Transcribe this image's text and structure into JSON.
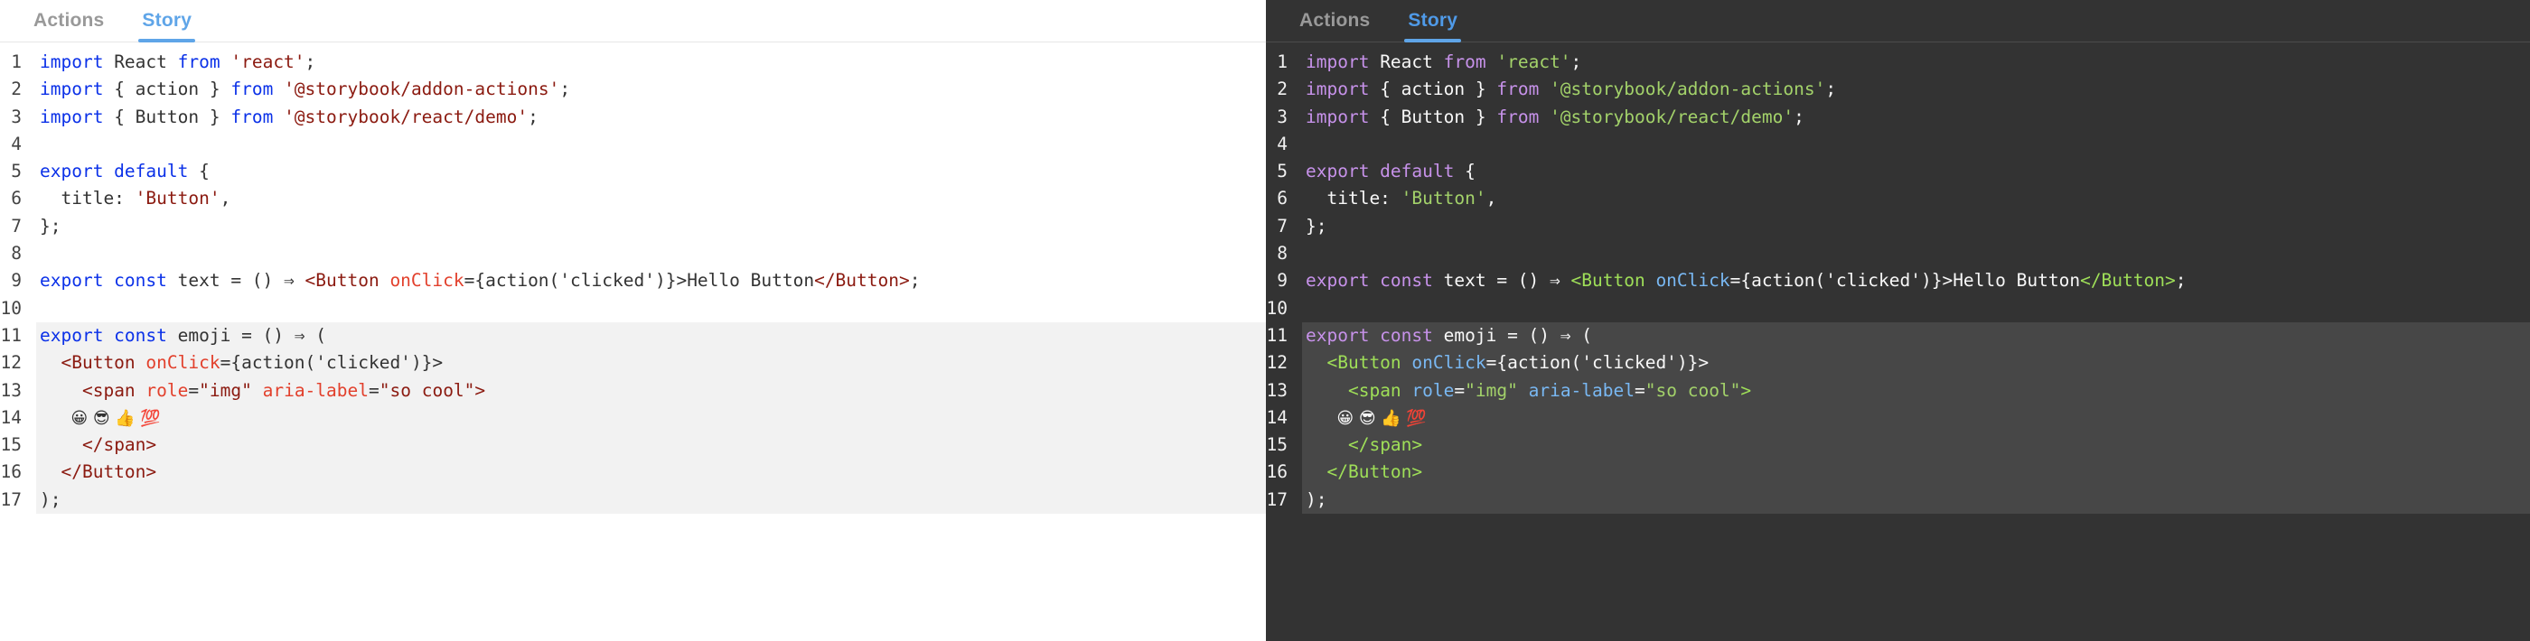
{
  "panels": [
    {
      "theme": "light",
      "tabs": [
        {
          "label": "Actions",
          "active": false
        },
        {
          "label": "Story",
          "active": true
        }
      ],
      "accent_color": "#5fa5e8",
      "background_color": "#ffffff",
      "highlight_color": "#f2f2f2",
      "syntax_colors": {
        "keyword": "#0b31e8",
        "string": "#8b1a10",
        "tag": "#8b1a10",
        "attribute": "#e2402c",
        "text": "#333333"
      }
    },
    {
      "theme": "dark",
      "tabs": [
        {
          "label": "Actions",
          "active": false
        },
        {
          "label": "Story",
          "active": true
        }
      ],
      "accent_color": "#4f9ae8",
      "background_color": "#333333",
      "highlight_color": "#474747",
      "syntax_colors": {
        "keyword": "#c792ea",
        "string": "#a3d26a",
        "tag": "#9fdf58",
        "attribute": "#79b8f3",
        "text": "#f8f8f8"
      }
    }
  ],
  "code": {
    "language": "jsx",
    "highlighted_lines": [
      11,
      12,
      13,
      14,
      15,
      16,
      17
    ],
    "lines": [
      {
        "n": "1",
        "tokens": [
          {
            "t": "kw",
            "s": "import"
          },
          {
            "t": "txt",
            "s": " React "
          },
          {
            "t": "kw",
            "s": "from"
          },
          {
            "t": "txt",
            "s": " "
          },
          {
            "t": "str",
            "s": "'react'"
          },
          {
            "t": "pun",
            "s": ";"
          }
        ]
      },
      {
        "n": "2",
        "tokens": [
          {
            "t": "kw",
            "s": "import"
          },
          {
            "t": "txt",
            "s": " { action } "
          },
          {
            "t": "kw",
            "s": "from"
          },
          {
            "t": "txt",
            "s": " "
          },
          {
            "t": "str",
            "s": "'@storybook/addon-actions'"
          },
          {
            "t": "pun",
            "s": ";"
          }
        ]
      },
      {
        "n": "3",
        "tokens": [
          {
            "t": "kw",
            "s": "import"
          },
          {
            "t": "txt",
            "s": " { Button } "
          },
          {
            "t": "kw",
            "s": "from"
          },
          {
            "t": "txt",
            "s": " "
          },
          {
            "t": "str",
            "s": "'@storybook/react/demo'"
          },
          {
            "t": "pun",
            "s": ";"
          }
        ]
      },
      {
        "n": "4",
        "tokens": []
      },
      {
        "n": "5",
        "tokens": [
          {
            "t": "kw",
            "s": "export default"
          },
          {
            "t": "txt",
            "s": " {"
          }
        ]
      },
      {
        "n": "6",
        "tokens": [
          {
            "t": "txt",
            "s": "  title: "
          },
          {
            "t": "str",
            "s": "'Button'"
          },
          {
            "t": "pun",
            "s": ","
          }
        ]
      },
      {
        "n": "7",
        "tokens": [
          {
            "t": "txt",
            "s": "};"
          }
        ]
      },
      {
        "n": "8",
        "tokens": []
      },
      {
        "n": "9",
        "tokens": [
          {
            "t": "kw",
            "s": "export const"
          },
          {
            "t": "txt",
            "s": " text = () ⇒ "
          },
          {
            "t": "tag",
            "s": "<Button "
          },
          {
            "t": "attr",
            "s": "onClick"
          },
          {
            "t": "txt",
            "s": "={action("
          },
          {
            "t": "txt",
            "s": "'clicked'"
          },
          {
            "t": "txt",
            "s": ")}>Hello Button"
          },
          {
            "t": "tag",
            "s": "</Button>"
          },
          {
            "t": "pun",
            "s": ";"
          }
        ]
      },
      {
        "n": "10",
        "tokens": []
      },
      {
        "n": "11",
        "tokens": [
          {
            "t": "kw",
            "s": "export const"
          },
          {
            "t": "txt",
            "s": " emoji = () ⇒ ("
          }
        ]
      },
      {
        "n": "12",
        "tokens": [
          {
            "t": "txt",
            "s": "  "
          },
          {
            "t": "tag",
            "s": "<Button "
          },
          {
            "t": "attr",
            "s": "onClick"
          },
          {
            "t": "txt",
            "s": "={action("
          },
          {
            "t": "txt",
            "s": "'clicked'"
          },
          {
            "t": "txt",
            "s": ")}>"
          }
        ]
      },
      {
        "n": "13",
        "tokens": [
          {
            "t": "txt",
            "s": "    "
          },
          {
            "t": "tag",
            "s": "<span "
          },
          {
            "t": "attr",
            "s": "role"
          },
          {
            "t": "txt",
            "s": "="
          },
          {
            "t": "str",
            "s": "\"img\""
          },
          {
            "t": "txt",
            "s": " "
          },
          {
            "t": "attr",
            "s": "aria-label"
          },
          {
            "t": "txt",
            "s": "="
          },
          {
            "t": "str",
            "s": "\"so cool\""
          },
          {
            "t": "tag",
            "s": ">"
          }
        ]
      },
      {
        "n": "14",
        "tokens": [
          {
            "t": "emoji",
            "s": "      😀 😎 👍 💯"
          }
        ]
      },
      {
        "n": "15",
        "tokens": [
          {
            "t": "txt",
            "s": "    "
          },
          {
            "t": "tag",
            "s": "</span>"
          }
        ]
      },
      {
        "n": "16",
        "tokens": [
          {
            "t": "txt",
            "s": "  "
          },
          {
            "t": "tag",
            "s": "</Button>"
          }
        ]
      },
      {
        "n": "17",
        "tokens": [
          {
            "t": "txt",
            "s": ");"
          }
        ]
      }
    ]
  }
}
